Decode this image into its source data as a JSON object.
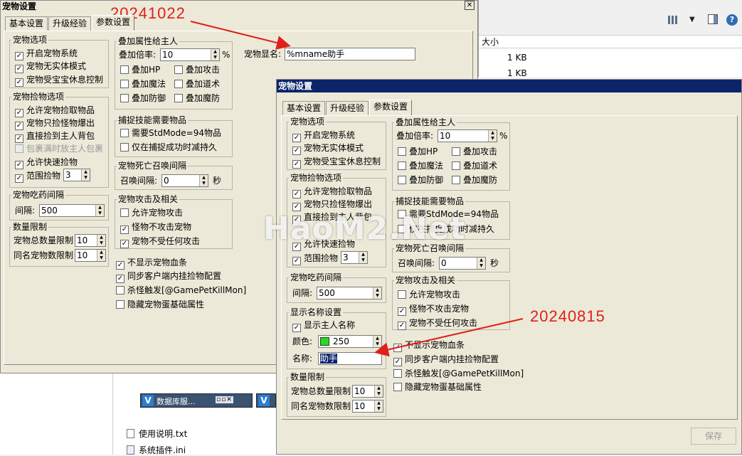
{
  "annotations": {
    "top_date": "20241022",
    "right_date": "20240815",
    "watermark": "HaoM2.Net"
  },
  "back_window": {
    "title": "宠物设置",
    "tabs": [
      "基本设置",
      "升级经验",
      "参数设置"
    ],
    "pet_options": {
      "title": "宠物选项",
      "items": [
        {
          "label": "开启宠物系统",
          "checked": true
        },
        {
          "label": "宠物无实体模式",
          "checked": true
        },
        {
          "label": "宠物受宝宝休息控制",
          "checked": true
        }
      ]
    },
    "pickup_options": {
      "title": "宠物捡物选项",
      "items": [
        {
          "label": "允许宠物捡取物品",
          "checked": true
        },
        {
          "label": "宠物只捡怪物爆出",
          "checked": true
        },
        {
          "label": "直接捡到主人背包",
          "checked": true
        },
        {
          "label": "包裹满时放主人包裹",
          "checked": false,
          "disabled": true
        },
        {
          "label": "允许快速捡物",
          "checked": true
        },
        {
          "label": "范围捡物",
          "checked": true
        }
      ],
      "range_value": "3"
    },
    "drug_interval": {
      "title": "宠物吃药间隔",
      "label": "间隔:",
      "value": "500"
    },
    "count_limit": {
      "title": "数量限制",
      "total_label": "宠物总数量限制",
      "total_value": "10",
      "same_label": "同名宠物数限制",
      "same_value": "10"
    },
    "stack_attr": {
      "title": "叠加属性给主人",
      "multiplier_label": "叠加倍率:",
      "multiplier_value": "10",
      "unit": "%",
      "items": [
        {
          "label": "叠加HP",
          "checked": false
        },
        {
          "label": "叠加攻击",
          "checked": false
        },
        {
          "label": "叠加魔法",
          "checked": false
        },
        {
          "label": "叠加道术",
          "checked": false
        },
        {
          "label": "叠加防御",
          "checked": false
        },
        {
          "label": "叠加魔防",
          "checked": false
        }
      ]
    },
    "capture": {
      "title": "捕捉技能需要物品",
      "items": [
        {
          "label": "需要StdMode=94物品",
          "checked": false
        },
        {
          "label": "仅在捕捉成功时减持久",
          "checked": false
        }
      ]
    },
    "revive": {
      "title": "宠物死亡召唤间隔",
      "label": "召唤间隔:",
      "value": "0",
      "unit": "秒"
    },
    "attack": {
      "title": "宠物攻击及相关",
      "items": [
        {
          "label": "允许宠物攻击",
          "checked": false
        },
        {
          "label": "怪物不攻击宠物",
          "checked": true
        },
        {
          "label": "宠物不受任何攻击",
          "checked": true
        }
      ]
    },
    "misc": [
      {
        "label": "不显示宠物血条",
        "checked": true
      },
      {
        "label": "同步客户端内挂捡物配置",
        "checked": true
      },
      {
        "label": "杀怪触发[@GamePetKillMon]",
        "checked": false
      },
      {
        "label": "隐藏宠物蛋基础属性",
        "checked": false
      }
    ],
    "display_name_label": "宠物显名:",
    "display_name_value": "%mname助手"
  },
  "right_panel": {
    "column": "大小",
    "rows": [
      "1 KB",
      "1 KB"
    ]
  },
  "taskbar": {
    "items": [
      "数据库服..."
    ]
  },
  "files": [
    "使用说明.txt",
    "系统插件.ini"
  ],
  "front_window": {
    "title": "宠物设置",
    "tabs": [
      "基本设置",
      "升级经验",
      "参数设置"
    ],
    "pet_options": {
      "title": "宠物选项",
      "items": [
        {
          "label": "开启宠物系统",
          "checked": true
        },
        {
          "label": "宠物无实体模式",
          "checked": true
        },
        {
          "label": "宠物受宝宝休息控制",
          "checked": true
        }
      ]
    },
    "pickup_options": {
      "title": "宠物捡物选项",
      "items": [
        {
          "label": "允许宠物捡取物品",
          "checked": true
        },
        {
          "label": "宠物只捡怪物爆出",
          "checked": true
        },
        {
          "label": "直接捡到主人背包",
          "checked": true
        },
        {
          "label": "允许快速捡物",
          "checked": true
        },
        {
          "label": "范围捡物",
          "checked": true
        }
      ],
      "range_value": "3"
    },
    "drug_interval": {
      "title": "宠物吃药间隔",
      "label": "间隔:",
      "value": "500"
    },
    "show_name": {
      "title": "显示名称设置",
      "show_owner_label": "显示主人名称",
      "show_owner_checked": true,
      "color_label": "颜色:",
      "color_value": "250",
      "color_swatch": "#22dd22",
      "name_label": "名称:",
      "name_value": "助手"
    },
    "count_limit": {
      "title": "数量限制",
      "total_label": "宠物总数量限制",
      "total_value": "10",
      "same_label": "同名宠物数限制",
      "same_value": "10"
    },
    "stack_attr": {
      "title": "叠加属性给主人",
      "multiplier_label": "叠加倍率:",
      "multiplier_value": "10",
      "unit": "%",
      "items": [
        {
          "label": "叠加HP",
          "checked": false
        },
        {
          "label": "叠加攻击",
          "checked": false
        },
        {
          "label": "叠加魔法",
          "checked": false
        },
        {
          "label": "叠加道术",
          "checked": false
        },
        {
          "label": "叠加防御",
          "checked": false
        },
        {
          "label": "叠加魔防",
          "checked": false
        }
      ]
    },
    "capture": {
      "title": "捕捉技能需要物品",
      "items": [
        {
          "label": "需要StdMode=94物品",
          "checked": false
        },
        {
          "label": "仅在捕捉成功时减持久",
          "checked": false
        }
      ]
    },
    "revive": {
      "title": "宠物死亡召唤间隔",
      "label": "召唤间隔:",
      "value": "0",
      "unit": "秒"
    },
    "attack": {
      "title": "宠物攻击及相关",
      "items": [
        {
          "label": "允许宠物攻击",
          "checked": false
        },
        {
          "label": "怪物不攻击宠物",
          "checked": true
        },
        {
          "label": "宠物不受任何攻击",
          "checked": true
        }
      ]
    },
    "misc": [
      {
        "label": "不显示宠物血条",
        "checked": true
      },
      {
        "label": "同步客户端内挂捡物配置",
        "checked": true
      },
      {
        "label": "杀怪触发[@GamePetKillMon]",
        "checked": false
      },
      {
        "label": "隐藏宠物蛋基础属性",
        "checked": false
      }
    ],
    "save_label": "保存"
  }
}
